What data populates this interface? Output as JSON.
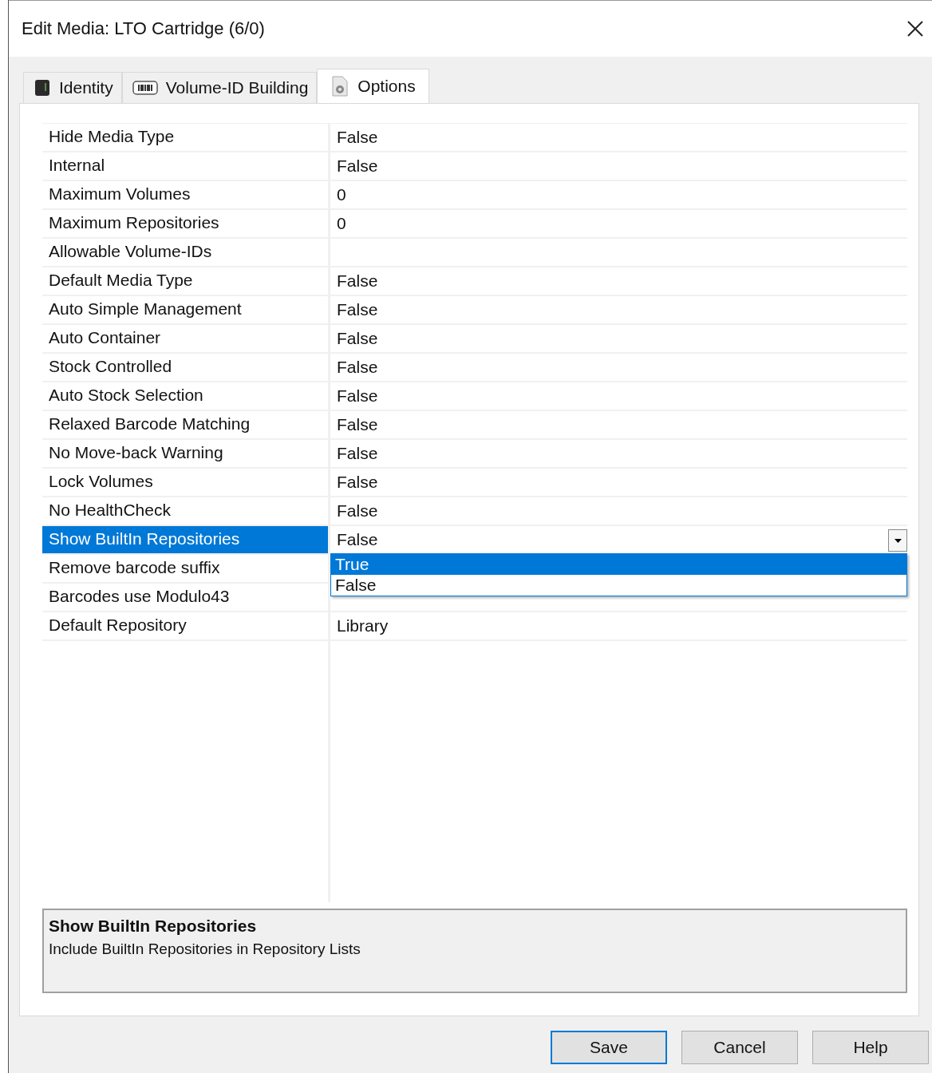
{
  "window": {
    "title": "Edit Media: LTO Cartridge (6/0)"
  },
  "tabs": [
    {
      "label": "Identity",
      "kind": "cartridge",
      "selected": false
    },
    {
      "label": "Volume-ID Building",
      "kind": "barcode",
      "selected": false
    },
    {
      "label": "Options",
      "kind": "gear",
      "selected": true
    }
  ],
  "properties": [
    {
      "name": "Hide Media Type",
      "value": "False",
      "selected": false
    },
    {
      "name": "Internal",
      "value": "False",
      "selected": false
    },
    {
      "name": "Maximum Volumes",
      "value": "0",
      "selected": false
    },
    {
      "name": "Maximum Repositories",
      "value": "0",
      "selected": false
    },
    {
      "name": "Allowable Volume-IDs",
      "selected": false
    },
    {
      "name": "Default Media Type",
      "value": "False",
      "selected": false
    },
    {
      "name": "Auto Simple Management",
      "value": "False",
      "selected": false
    },
    {
      "name": "Auto Container",
      "value": "False",
      "selected": false
    },
    {
      "name": "Stock Controlled",
      "value": "False",
      "selected": false
    },
    {
      "name": "Auto Stock Selection",
      "value": "False",
      "selected": false
    },
    {
      "name": "Relaxed Barcode Matching",
      "value": "False",
      "selected": false
    },
    {
      "name": "No Move-back Warning",
      "value": "False",
      "selected": false
    },
    {
      "name": "Lock Volumes",
      "value": "False",
      "selected": false
    },
    {
      "name": "No HealthCheck",
      "value": "False",
      "selected": false
    },
    {
      "name": "Show BuiltIn Repositories",
      "value": "False",
      "selected": true,
      "dropdown": {
        "options": [
          {
            "label": "True",
            "selected": true
          },
          {
            "label": "False",
            "selected": false
          }
        ]
      }
    },
    {
      "name": "Remove barcode suffix",
      "selected": false
    },
    {
      "name": "Barcodes use Modulo43",
      "selected": false
    },
    {
      "name": "Default Repository",
      "value": "Library",
      "selected": false
    }
  ],
  "description": {
    "title": "Show BuiltIn Repositories",
    "text": "Include BuiltIn Repositories in Repository Lists"
  },
  "buttons": [
    {
      "label": "Save",
      "default": true
    },
    {
      "label": "Cancel",
      "default": false
    },
    {
      "label": "Help",
      "default": false
    }
  ]
}
